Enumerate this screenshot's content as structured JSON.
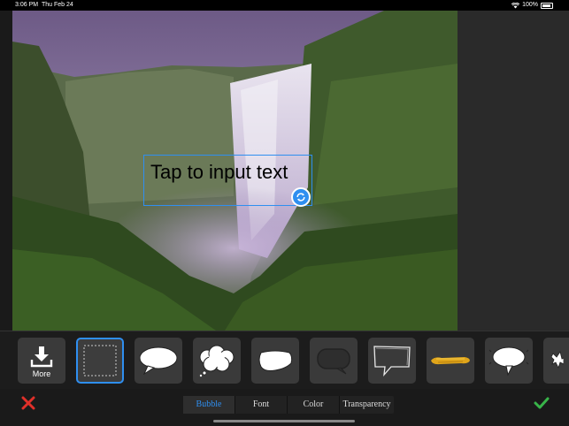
{
  "status_bar": {
    "time": "3:06 PM",
    "date": "Thu Feb 24",
    "battery": "100%"
  },
  "canvas": {
    "text_placeholder": "Tap to input text"
  },
  "bubble_tray": {
    "more_label": "More",
    "items": [
      {
        "icon": "download-icon",
        "selected": false
      },
      {
        "icon": "no-bubble-icon",
        "selected": true
      },
      {
        "icon": "oval-bubble-icon",
        "selected": false
      },
      {
        "icon": "cloud-bubble-icon",
        "selected": false
      },
      {
        "icon": "shout-bubble-icon",
        "selected": false
      },
      {
        "icon": "dark-bubble-icon",
        "selected": false
      },
      {
        "icon": "sketch-bubble-icon",
        "selected": false
      },
      {
        "icon": "brush-stroke-icon",
        "selected": false
      },
      {
        "icon": "round-bubble-icon",
        "selected": false
      },
      {
        "icon": "burst-bubble-icon",
        "selected": false
      }
    ]
  },
  "bottom_bar": {
    "tabs": [
      {
        "label": "Bubble",
        "active": true
      },
      {
        "label": "Font",
        "active": false
      },
      {
        "label": "Color",
        "active": false
      },
      {
        "label": "Transparency",
        "active": false
      }
    ]
  },
  "colors": {
    "accent": "#2f8ff0",
    "cancel": "#e0302a",
    "confirm": "#38b449"
  }
}
